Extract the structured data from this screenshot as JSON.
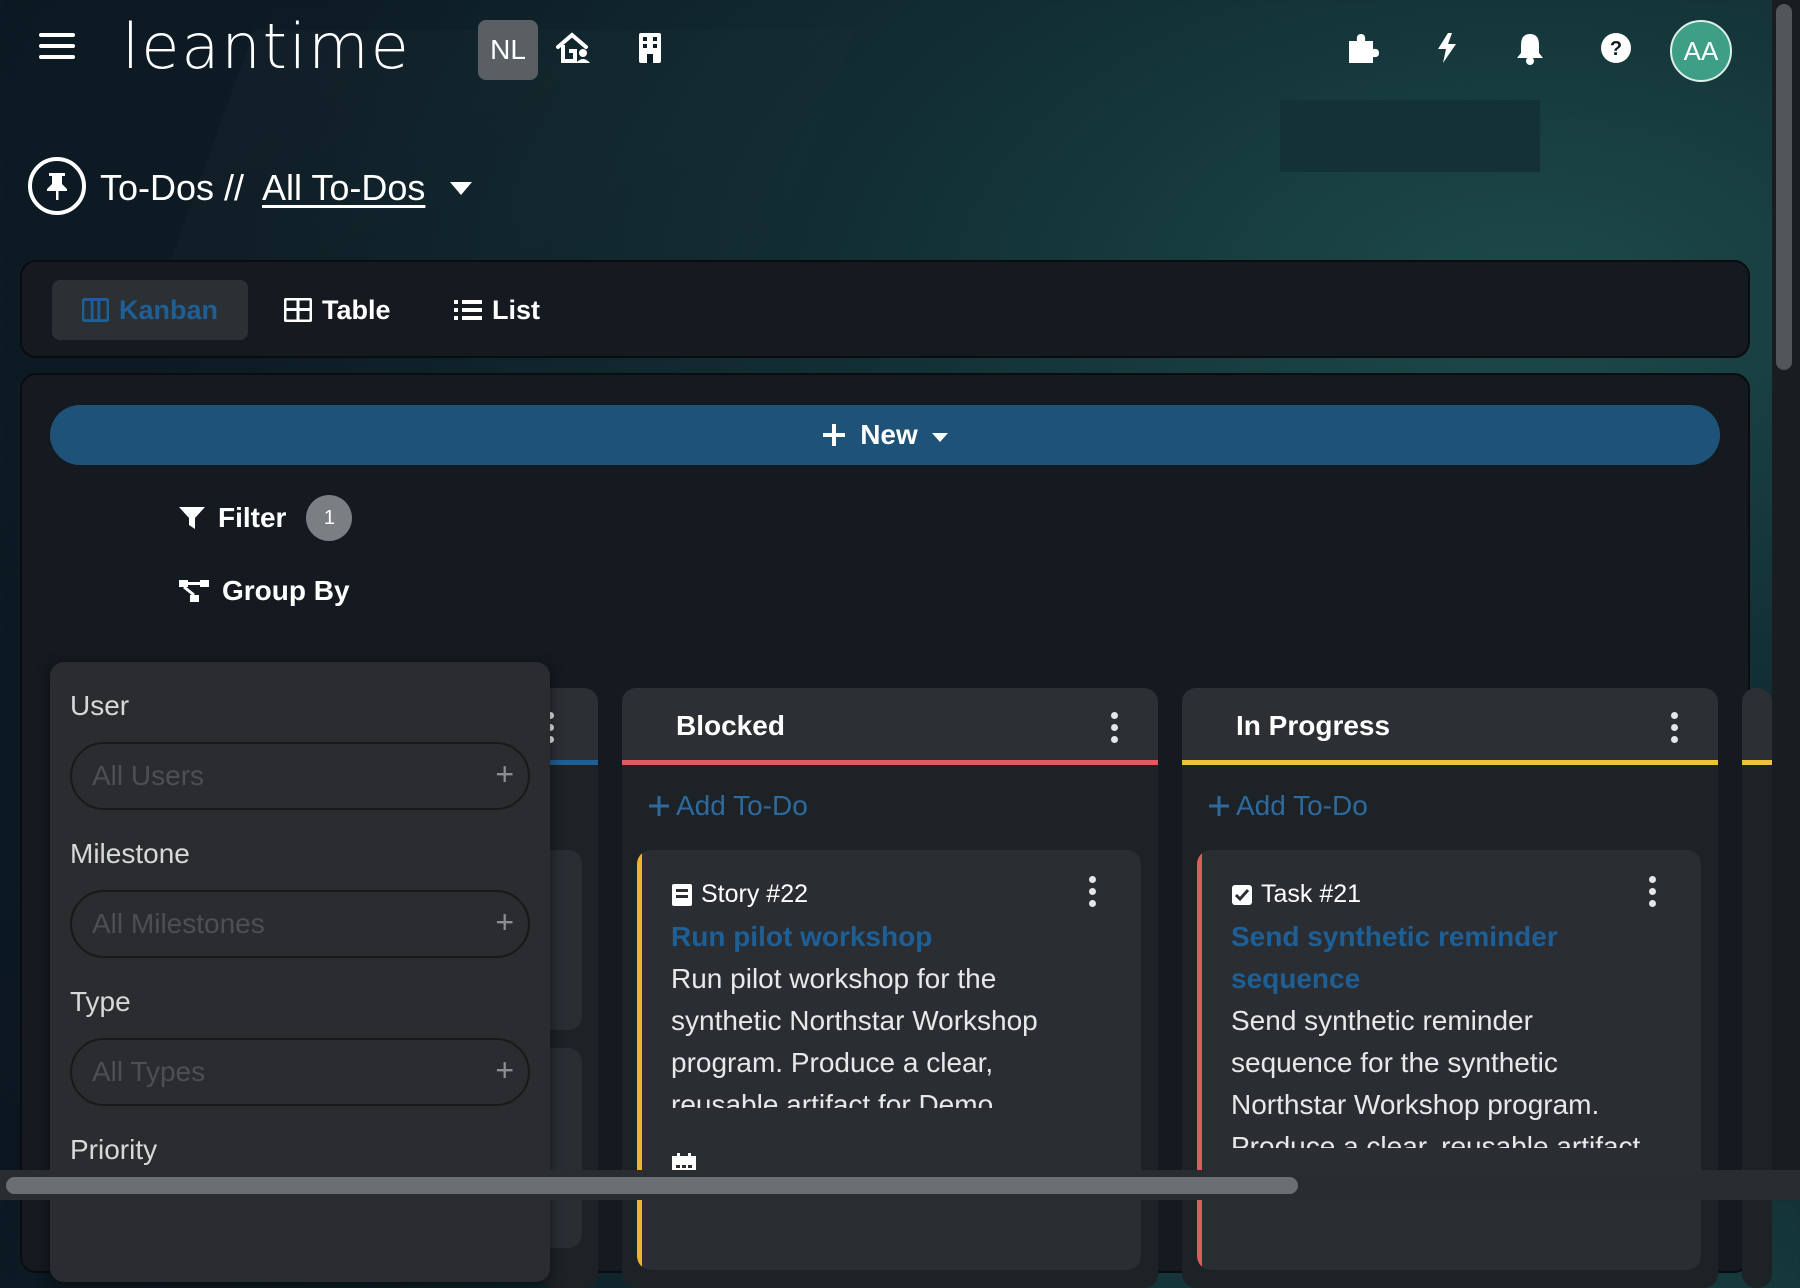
{
  "header": {
    "logo": "leantime",
    "workspace_badge": "NL",
    "avatar_initials": "AA",
    "icons": [
      "menu-icon",
      "house-user-icon",
      "building-icon",
      "puzzle-icon",
      "bolt-icon",
      "bell-icon",
      "help-icon"
    ]
  },
  "page": {
    "title_prefix": "To-Dos //",
    "title_link": "All To-Dos"
  },
  "view_tabs": [
    {
      "label": "Kanban",
      "icon": "kanban-icon",
      "active": true
    },
    {
      "label": "Table",
      "icon": "table-icon",
      "active": false
    },
    {
      "label": "List",
      "icon": "list-icon",
      "active": false
    }
  ],
  "toolbar": {
    "new_label": "New",
    "filter_label": "Filter",
    "filter_count": "1",
    "group_by_label": "Group By"
  },
  "filters": {
    "user": {
      "label": "User",
      "placeholder": "All Users"
    },
    "milestone": {
      "label": "Milestone",
      "placeholder": "All Milestones"
    },
    "type": {
      "label": "Type",
      "placeholder": "All Types"
    },
    "priority": {
      "label": "Priority"
    }
  },
  "columns": [
    {
      "title": "Blocked",
      "accent": "#e05c5c",
      "add_label": "Add To-Do",
      "card": {
        "type_label": "Story #22",
        "title": "Run pilot workshop",
        "description": "Run pilot workshop for the synthetic Northstar Workshop program. Produce a clear, reusable artifact for Demo Cooperative and",
        "accent": "#f0b429"
      }
    },
    {
      "title": "In Progress",
      "accent": "#f0c23b",
      "add_label": "Add To-Do",
      "card": {
        "type_label": "Task #21",
        "title": "Send synthetic reminder sequence",
        "description": "Send synthetic reminder sequence for the synthetic Northstar Workshop program. Produce a clear, reusable artifact for Demo",
        "accent": "#e05c5c"
      }
    }
  ],
  "colors": {
    "primary": "#1f5279",
    "link": "#1e5f96",
    "blocked": "#e05c5c",
    "in_progress": "#f0c23b",
    "avatar": "#3e9e86"
  }
}
